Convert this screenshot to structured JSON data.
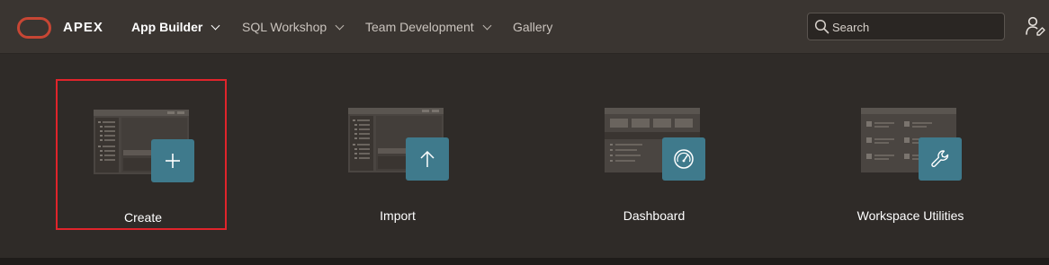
{
  "header": {
    "brand": "APEX",
    "nav": [
      {
        "label": "App Builder",
        "active": true,
        "has_menu": true
      },
      {
        "label": "SQL Workshop",
        "active": false,
        "has_menu": true
      },
      {
        "label": "Team Development",
        "active": false,
        "has_menu": true
      },
      {
        "label": "Gallery",
        "active": false,
        "has_menu": false
      }
    ],
    "search": {
      "placeholder": "Search",
      "value": ""
    },
    "icons": {
      "logo": "oracle-logo",
      "search": "search-icon",
      "user": "user-settings-icon"
    }
  },
  "tiles": [
    {
      "label": "Create",
      "icon": "plus-icon",
      "selected": true
    },
    {
      "label": "Import",
      "icon": "arrow-up-icon",
      "selected": false
    },
    {
      "label": "Dashboard",
      "icon": "gauge-icon",
      "selected": false
    },
    {
      "label": "Workspace Utilities",
      "icon": "wrench-icon",
      "selected": false
    }
  ],
  "colors": {
    "background": "#2f2b28",
    "topbar": "#3a3531",
    "accent": "#3f7a8c",
    "logo": "#c74634",
    "selection": "#e0242b"
  }
}
